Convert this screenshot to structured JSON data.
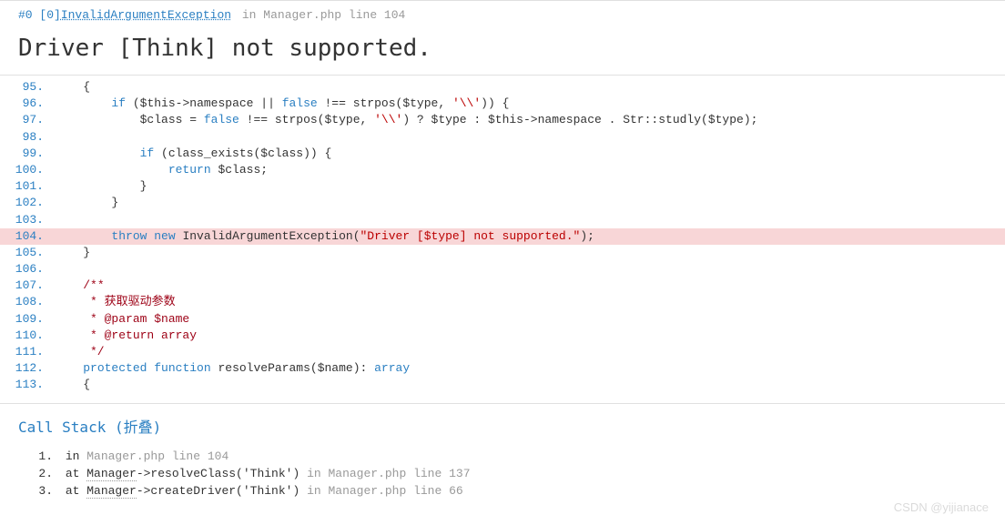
{
  "header": {
    "frame": "#0",
    "bracket": "[0]",
    "exception": "InvalidArgumentException",
    "in": "in",
    "file_ref": "Manager.php line 104"
  },
  "error_title": "Driver [Think] not supported.",
  "code": {
    "lines": [
      {
        "n": "95.",
        "hl": false,
        "html": "    {"
      },
      {
        "n": "96.",
        "hl": false,
        "html": "        <span class='kw'>if</span> (<span class='var'>$this</span><span class='op'>-&gt;</span>namespace || <span class='kw'>false</span> !== strpos(<span class='var'>$type</span>, <span class='str'>'\\\\'</span>)) {"
      },
      {
        "n": "97.",
        "hl": false,
        "html": "            <span class='var'>$class</span> = <span class='kw'>false</span> !== strpos(<span class='var'>$type</span>, <span class='str'>'\\\\'</span>) ? <span class='var'>$type</span> : <span class='var'>$this</span><span class='op'>-&gt;</span>namespace . Str::studly(<span class='var'>$type</span>);"
      },
      {
        "n": "98.",
        "hl": false,
        "html": ""
      },
      {
        "n": "99.",
        "hl": false,
        "html": "            <span class='kw'>if</span> (class_exists(<span class='var'>$class</span>)) {"
      },
      {
        "n": "100.",
        "hl": false,
        "html": "                <span class='kw'>return</span> <span class='var'>$class</span>;"
      },
      {
        "n": "101.",
        "hl": false,
        "html": "            }"
      },
      {
        "n": "102.",
        "hl": false,
        "html": "        }"
      },
      {
        "n": "103.",
        "hl": false,
        "html": ""
      },
      {
        "n": "104.",
        "hl": true,
        "html": "        <span class='kw'>throw</span> <span class='kw'>new</span> InvalidArgumentException(<span class='str'>\"Driver [$type] not supported.\"</span>);"
      },
      {
        "n": "105.",
        "hl": false,
        "html": "    }"
      },
      {
        "n": "106.",
        "hl": false,
        "html": ""
      },
      {
        "n": "107.",
        "hl": false,
        "html": "    <span class='comment'>/**</span>"
      },
      {
        "n": "108.",
        "hl": false,
        "html": "<span class='comment'>     * 获取驱动参数</span>"
      },
      {
        "n": "109.",
        "hl": false,
        "html": "<span class='comment'>     * @param $name</span>"
      },
      {
        "n": "110.",
        "hl": false,
        "html": "<span class='comment'>     * @return array</span>"
      },
      {
        "n": "111.",
        "hl": false,
        "html": "<span class='comment'>     */</span>"
      },
      {
        "n": "112.",
        "hl": false,
        "html": "    <span class='kw'>protected</span> <span class='kw'>function</span> resolveParams(<span class='var'>$name</span>): <span class='kw'>array</span>"
      },
      {
        "n": "113.",
        "hl": false,
        "html": "    {"
      }
    ]
  },
  "call_stack": {
    "title": "Call Stack (折叠)",
    "items": [
      {
        "idx": "1.",
        "prefix": "in ",
        "file": "Manager.php line 104",
        "method": "",
        "args": "",
        "file2": ""
      },
      {
        "idx": "2.",
        "prefix": "at ",
        "class": "Manager",
        "method": "->resolveClass('Think') ",
        "in": "in ",
        "file": "Manager.php line 137"
      },
      {
        "idx": "3.",
        "prefix": "at ",
        "class": "Manager",
        "method": "->createDriver('Think') ",
        "in": "in ",
        "file": "Manager.php line 66"
      }
    ]
  },
  "watermark": "CSDN @yijianace"
}
